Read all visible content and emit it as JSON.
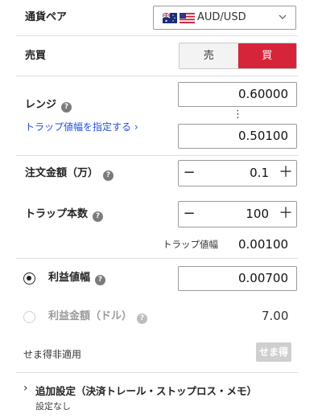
{
  "pair": {
    "label": "通貨ペア",
    "value": "AUD/USD",
    "icon": "chevron-down-icon"
  },
  "side": {
    "label": "売買",
    "sell": "売",
    "buy": "買",
    "active": "buy",
    "active_color": "#d6243a"
  },
  "range": {
    "label": "レンジ",
    "high": "0.60000",
    "separator": "⋮",
    "low": "0.50100",
    "link": "トラップ値幅を指定する ›"
  },
  "order_amount": {
    "label": "注文金額（万）",
    "value": "0.1",
    "minus": "−",
    "plus": "＋"
  },
  "trap_count": {
    "label": "トラップ本数",
    "value": "100",
    "minus": "−",
    "plus": "＋"
  },
  "trap_width": {
    "label": "トラップ値幅",
    "value": "0.00100"
  },
  "profit_width": {
    "label": "利益値幅",
    "value": "0.00700",
    "selected": true
  },
  "profit_amount": {
    "label": "利益金額（ドル）",
    "value": "7.00",
    "selected": false
  },
  "semaetoku": {
    "label": "せま得非適用",
    "badge": "せま得"
  },
  "advanced": {
    "label": "追加設定（決済トレール・ストップロス・メモ）",
    "sub": "設定なし",
    "chevron": "›"
  },
  "help_glyph": "?"
}
